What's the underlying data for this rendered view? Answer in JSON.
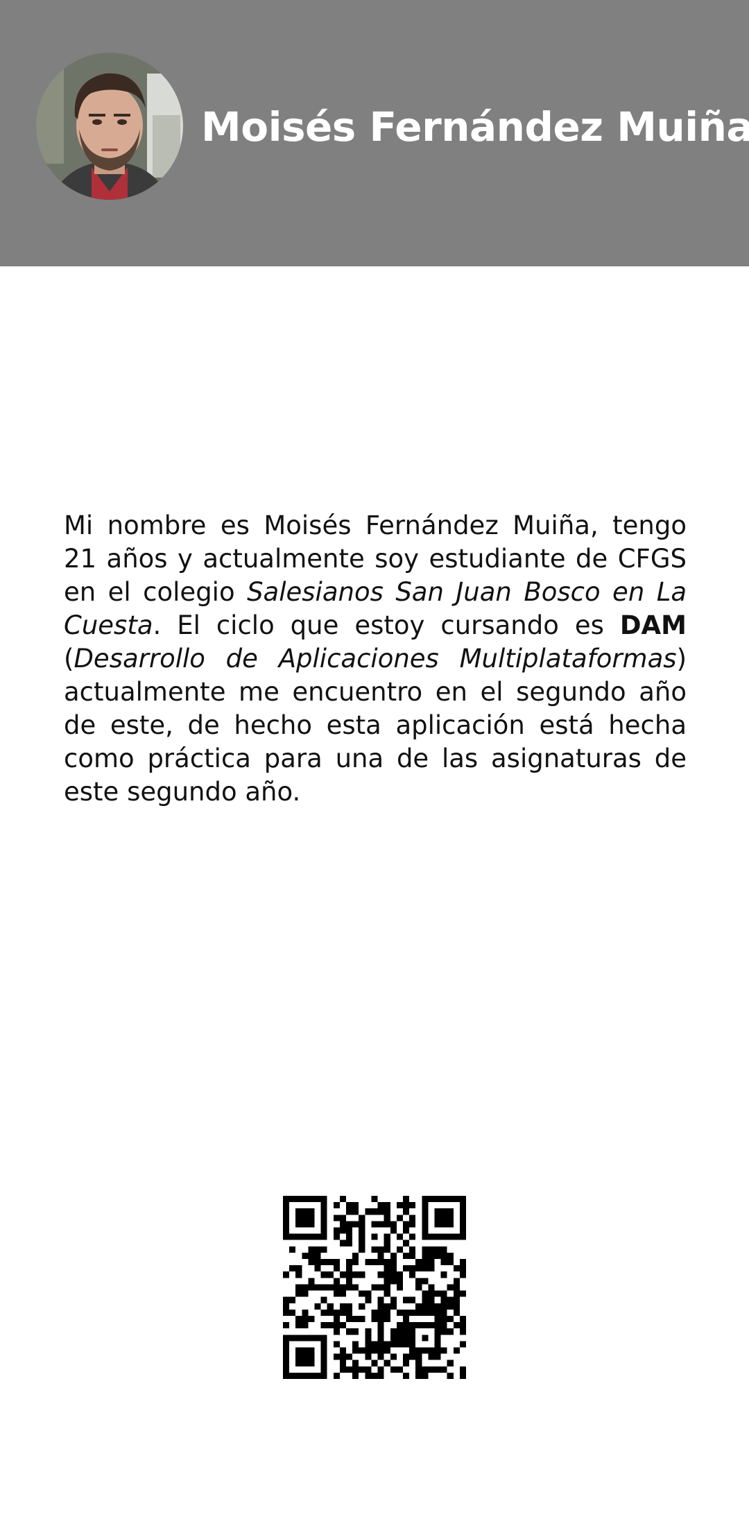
{
  "header": {
    "name": "Moisés Fernández Muiña",
    "background_color": "#808080",
    "avatar_icon": "profile-photo"
  },
  "bio": {
    "part1": "Mi nombre es Moisés Fernández Muiña, tengo 21 años y actualmente soy estudiante de CFGS en el colegio ",
    "school": "Salesianos San Juan Bosco en La Cuesta",
    "part2": ". El ciclo que estoy cursando es ",
    "course_abbr": "DAM",
    "part3": " (",
    "course_full": "Desarrollo de Aplicaciones Multiplataformas",
    "part4": ") actualmente me encuentro en el segundo año de este, de hecho esta aplicación está hecha como práctica para una de las asignaturas de este segundo año."
  },
  "qr_code": {
    "icon": "qr-code-icon"
  }
}
